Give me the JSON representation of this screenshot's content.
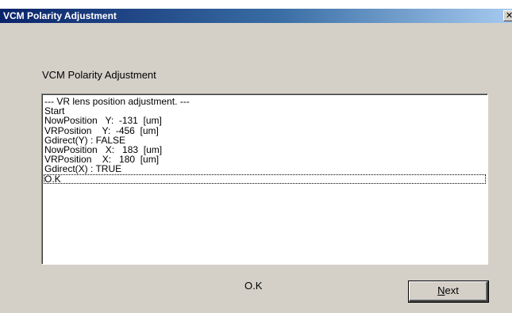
{
  "window": {
    "title": "VCM Polarity Adjustment",
    "close_label": "✕"
  },
  "main": {
    "heading": "VCM Polarity Adjustment",
    "log_lines": [
      "--- VR lens position adjustment. ---",
      "Start",
      "NowPosition   Y:  -131  [um]",
      "VRPosition    Y:  -456  [um]",
      "Gdirect(Y) : FALSE",
      "NowPosition   X:   183  [um]",
      "VRPosition    X:   180  [um]",
      "Gdirect(X) : TRUE",
      "O.K"
    ],
    "selected_line_index": 8,
    "status": "O.K"
  },
  "buttons": {
    "next_accel": "N",
    "next_rest": "ext"
  },
  "colors": {
    "titlebar_start": "#0a246a",
    "titlebar_end": "#a6caf0",
    "dialog_background": "#d4d0c8",
    "log_background": "#ffffff"
  }
}
